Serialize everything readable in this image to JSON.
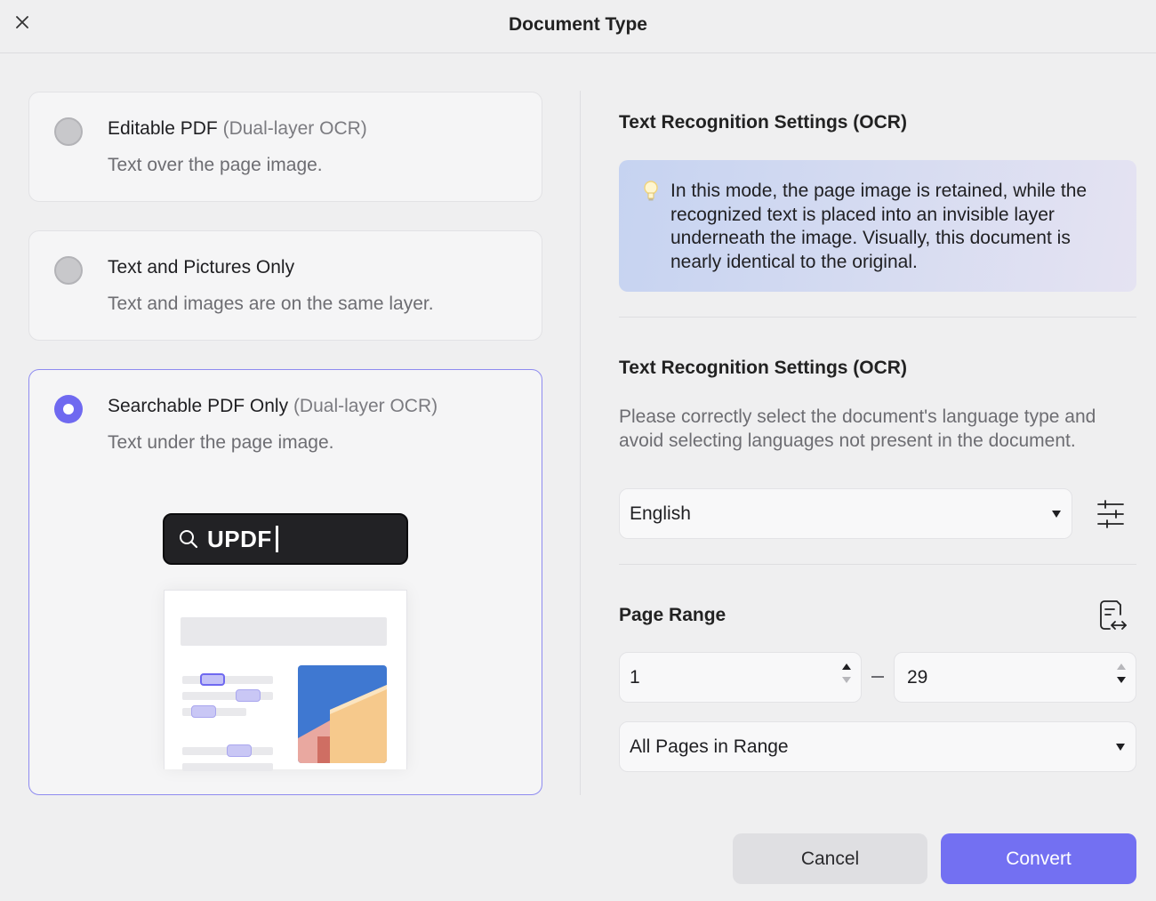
{
  "dialog": {
    "title": "Document Type"
  },
  "options": [
    {
      "title": "Editable PDF",
      "title_suffix": "(Dual-layer OCR)",
      "description": "Text over the page image.",
      "selected": false
    },
    {
      "title": "Text and Pictures Only",
      "title_suffix": "",
      "description": "Text and images are on the same layer.",
      "selected": false
    },
    {
      "title": "Searchable PDF Only",
      "title_suffix": "(Dual-layer OCR)",
      "description": "Text under the page image.",
      "selected": true
    }
  ],
  "illustration": {
    "search_text": "UPDF"
  },
  "ocr_info": {
    "title": "Text Recognition Settings (OCR)",
    "message": "In this mode, the page image is retained, while the recognized text is placed into an invisible layer underneath the image. Visually, this document is nearly identical to the original."
  },
  "language": {
    "title": "Text Recognition Settings (OCR)",
    "help": "Please correctly select the document's language type and avoid selecting languages not present in the document.",
    "selected": "English"
  },
  "page_range": {
    "title": "Page Range",
    "from": "1",
    "to": "29",
    "subset": "All Pages in Range"
  },
  "buttons": {
    "cancel": "Cancel",
    "convert": "Convert"
  },
  "colors": {
    "accent": "#7370f2",
    "selected_border": "#8e8bf0"
  }
}
